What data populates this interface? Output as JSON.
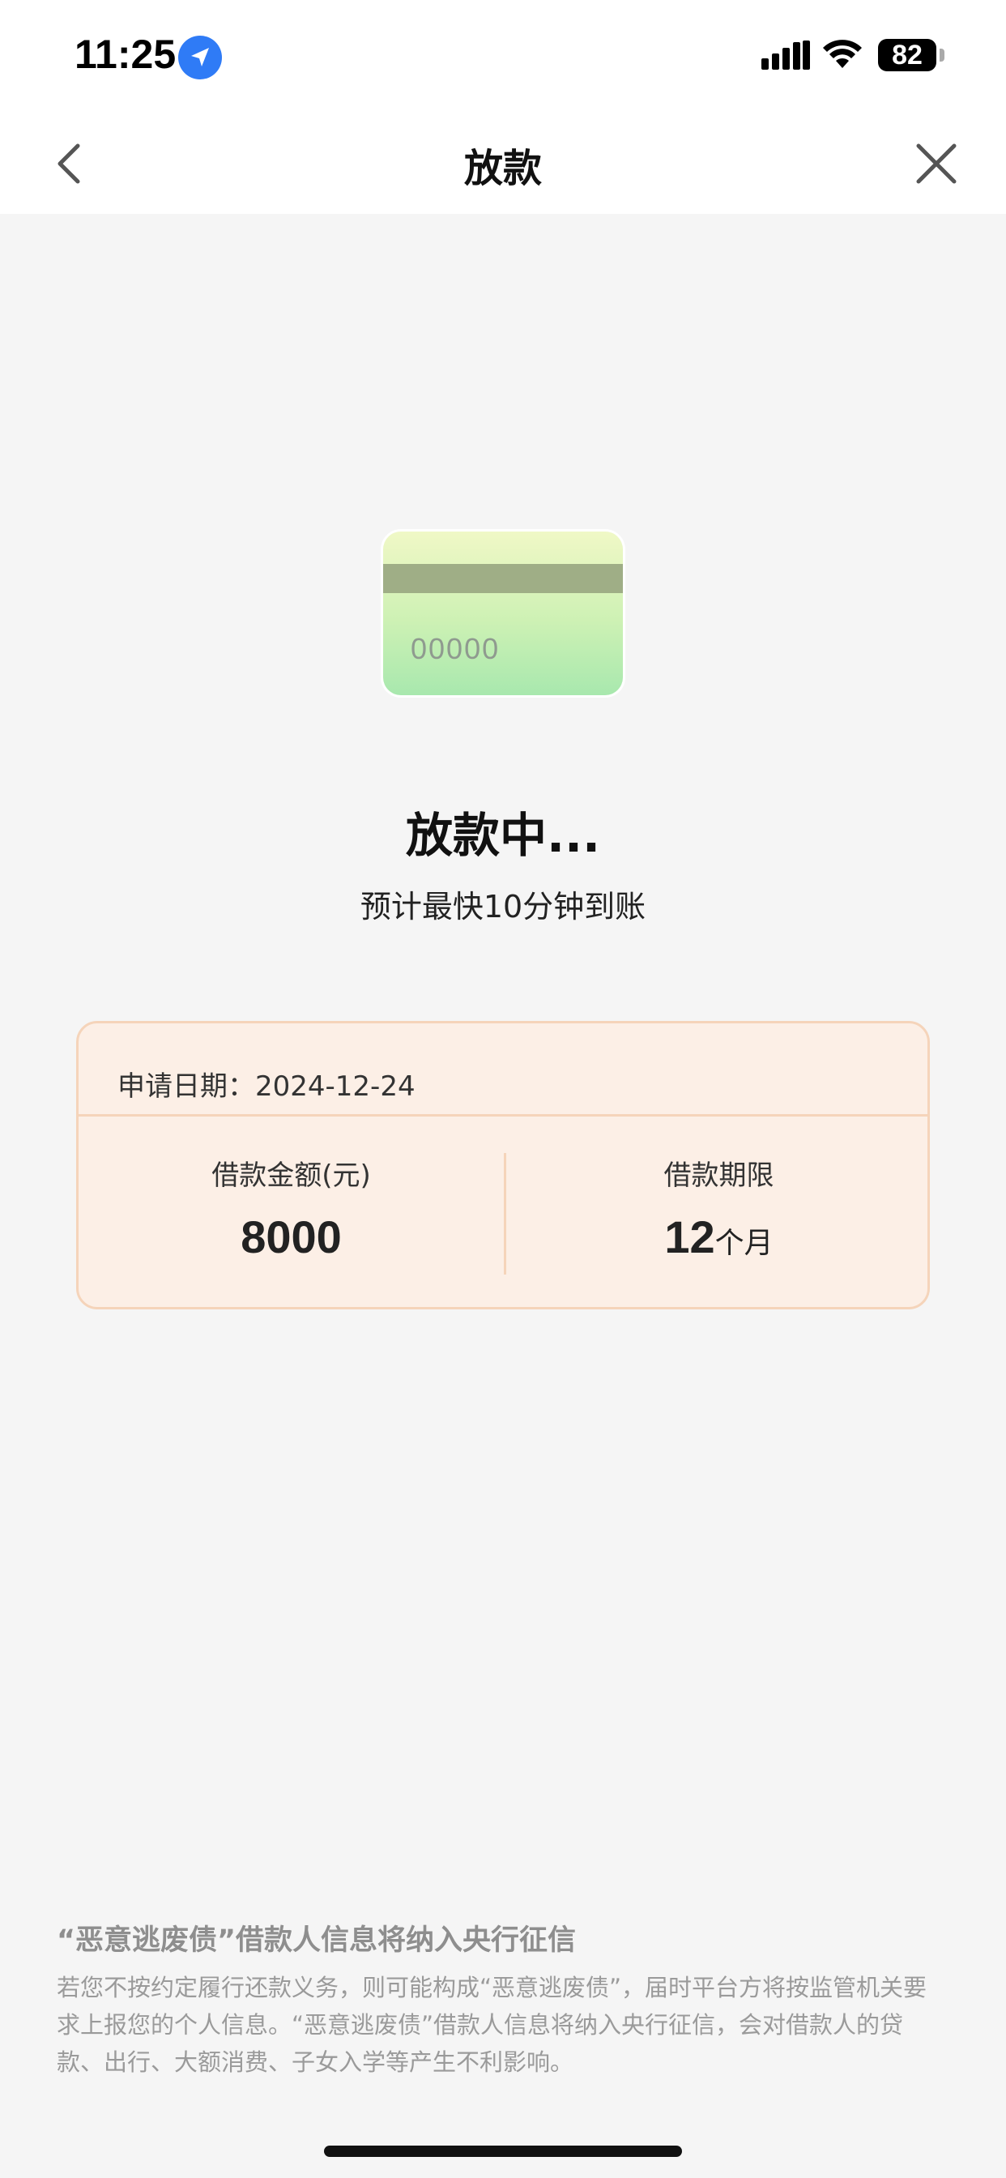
{
  "status_bar": {
    "time": "11:25",
    "battery": "82",
    "icons": [
      "location-arrow-icon",
      "signal-icon",
      "wifi-icon",
      "battery-icon"
    ]
  },
  "nav": {
    "title": "放款",
    "back_icon": "chevron-left-icon",
    "close_icon": "close-icon"
  },
  "illustration": {
    "card_number": "00000"
  },
  "status": {
    "title": "放款中...",
    "subtitle": "预计最快10分钟到账"
  },
  "info": {
    "apply_date": "申请日期：2024-12-24",
    "amount_label": "借款金额(元)",
    "amount_value": "8000",
    "term_label": "借款期限",
    "term_value": "12",
    "term_unit": "个月"
  },
  "notice": {
    "title": "“恶意逃废债”借款人信息将纳入央行征信",
    "body": "若您不按约定履行还款义务，则可能构成“恶意逃废债”，届时平台方将按监管机关要求上报您的个人信息。“恶意逃废债”借款人信息将纳入央行征信，会对借款人的贷款、出行、大额消费、子女入学等产生不利影响。"
  },
  "colors": {
    "accent_blue": "#2f7bf6",
    "card_bg": "#fcefe6",
    "card_border": "#f5d4ba",
    "page_bg": "#f5f5f5"
  }
}
